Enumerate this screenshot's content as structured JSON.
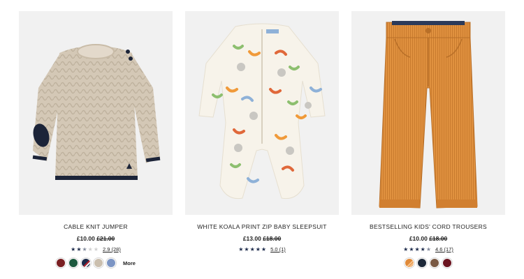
{
  "products": [
    {
      "title": "CABLE KNIT JUMPER",
      "price_now": "£10.00",
      "price_was": "£21.00",
      "stars": [
        1,
        1,
        0.5,
        0,
        0
      ],
      "rating_text": "2.9 (28)",
      "swatch_colors": [
        "#7a1f22",
        "#1d5a3f",
        "stripe",
        "#cbbfae",
        "#7c95c4"
      ],
      "more_label": "More",
      "image_icon": "cable-knit-jumper-image"
    },
    {
      "title": "WHITE KOALA PRINT ZIP BABY SLEEPSUIT",
      "price_now": "£13.00",
      "price_was": "£18.00",
      "stars": [
        1,
        1,
        1,
        1,
        1
      ],
      "rating_text": "5.0 (1)",
      "swatch_colors": [],
      "more_label": "",
      "image_icon": "koala-sleepsuit-image"
    },
    {
      "title": "BESTSELLING KIDS' CORD TROUSERS",
      "price_now": "£10.00",
      "price_was": "£18.00",
      "stars": [
        1,
        1,
        1,
        1,
        0.5
      ],
      "rating_text": "4.6 (17)",
      "swatch_colors": [
        "cord",
        "#1c2838",
        "#7a5a44",
        "#6b1420"
      ],
      "more_label": "",
      "image_icon": "cord-trousers-image"
    }
  ],
  "colors": {
    "star_full": "#1c2a4a",
    "star_empty": "#cfcfcf",
    "image_bg": "#f1f1f1"
  }
}
